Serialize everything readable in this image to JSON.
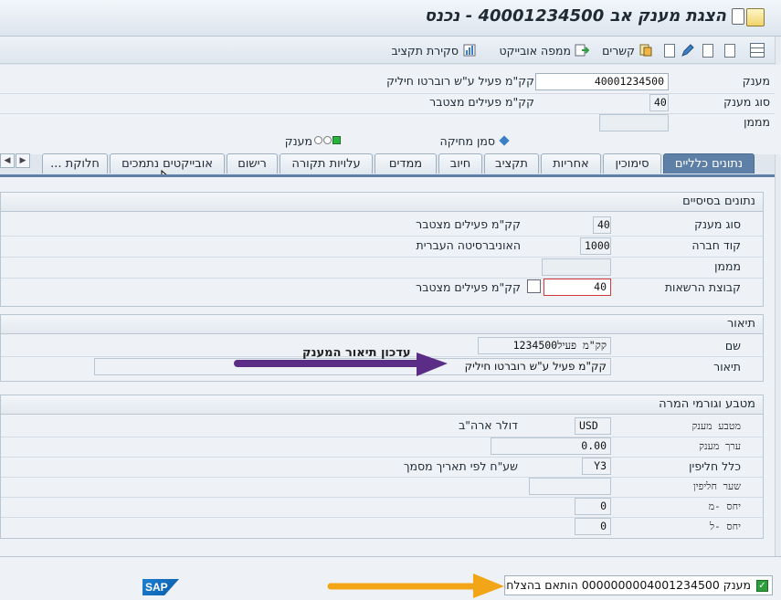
{
  "title": "הצגת מענק אב 40001234500 - נכנס",
  "toolbar": {
    "items": [
      {
        "label": "",
        "icon": "table-icon"
      },
      {
        "label": "",
        "icon": "next-doc-icon"
      },
      {
        "label": "",
        "icon": "prev-doc-icon"
      },
      {
        "label": "",
        "icon": "pencil-icon"
      },
      {
        "label": "",
        "icon": "new-doc-icon"
      },
      {
        "label": "קשרים",
        "icon": "relations-icon"
      },
      {
        "label": "ממפה אובייקט",
        "icon": "mapper-icon"
      },
      {
        "label": "סקירת תקציב",
        "icon": "budget-icon"
      }
    ]
  },
  "header": {
    "grant_label": "מענק",
    "grant_value": "40001234500",
    "grant_desc": "קק\"מ פעיל ע\"ש רוברטו חיליק",
    "grant_type_label": "סוג מענק",
    "grant_type_value": "40",
    "grant_type_desc": "קק\"מ פעילים מצטבר",
    "sponsor_label": "מממן",
    "sponsor_value": "",
    "deletion_flag_label": "סמן מחיקה",
    "grant_status_label": "מענק"
  },
  "tabs": [
    {
      "label": "נתונים כלליים",
      "active": true
    },
    {
      "label": "סימוכין"
    },
    {
      "label": "אחריות"
    },
    {
      "label": "תקציב"
    },
    {
      "label": "חיוב"
    },
    {
      "label": "ממדים"
    },
    {
      "label": "עלויות תקורה"
    },
    {
      "label": "רישום"
    },
    {
      "label": "אובייקטים נתמכים"
    },
    {
      "label": "חלוקת ..."
    }
  ],
  "basic": {
    "title": "נתונים בסיסיים",
    "grant_type_label": "סוג מענק",
    "grant_type_value": "40",
    "grant_type_desc": "קק\"מ פעילים מצטבר",
    "company_code_label": "קוד חברה",
    "company_code_value": "1000",
    "company_code_desc": "האוניברסיטה העברית",
    "sponsor_label": "מממן",
    "sponsor_value": "",
    "auth_group_label": "קבוצת הרשאות",
    "auth_group_value": "40",
    "auth_group_desc": "קק\"מ פעילים מצטבר"
  },
  "description": {
    "title": "תיאור",
    "name_label": "שם",
    "name_value": "קק\"מ פעיל1234500",
    "desc_label": "תיאור",
    "desc_value": "קק\"מ פעיל ע\"ש רוברטו חיליק",
    "annotation": "עדכון תיאור המענק"
  },
  "currency": {
    "title": "מטבע וגורמי המרה",
    "grant_currency_label": "מטבע מענק",
    "grant_currency_value": "USD",
    "grant_currency_desc": "דולר ארה\"ב",
    "grant_value_label": "ערך מענק",
    "grant_value_value": "0.00",
    "exchange_rule_label": "כלל חליפין",
    "exchange_rule_value": "Y3",
    "exchange_rule_desc": "שע\"ח לפי תאריך מסמך",
    "exchange_rate_label": "שער חליפין",
    "exchange_rate_value": "",
    "ratio_from_label": "יחס -מ",
    "ratio_from_value": "0",
    "ratio_to_label": "יחס -ל",
    "ratio_to_value": "0"
  },
  "status": {
    "message": "מענק 0000000004001234500 הותאם בהצלחה",
    "logo": "SAP"
  },
  "colors": {
    "purple_arrow": "#5b2d86",
    "orange_arrow": "#f2a516",
    "active_tab": "#5e80a6"
  }
}
